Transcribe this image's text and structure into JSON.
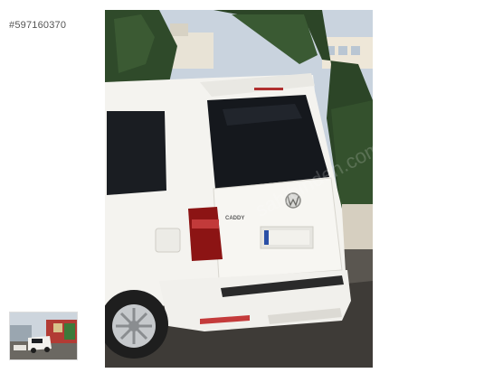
{
  "listing": {
    "id_label": "#597160370"
  },
  "photo": {
    "plate_text": "CADDY",
    "watermark_text": "sahibinden.com",
    "icon": "vw-logo-icon"
  },
  "thumbnails": [
    {
      "icon": "thumbnail-image"
    }
  ]
}
